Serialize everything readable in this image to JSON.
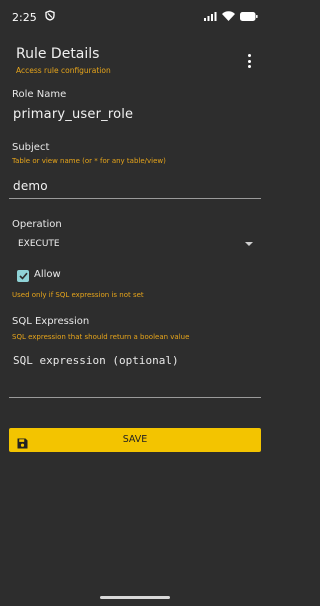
{
  "status_bar": {
    "time": "2:25"
  },
  "header": {
    "title": "Rule Details",
    "subtitle": "Access rule configuration"
  },
  "form": {
    "role_name": {
      "label": "Role Name",
      "value": "primary_user_role"
    },
    "subject": {
      "label": "Subject",
      "hint": "Table or view name (or * for any table/view)",
      "value": "demo"
    },
    "operation": {
      "label": "Operation",
      "selected": "EXECUTE"
    },
    "allow": {
      "label": "Allow",
      "checked": true,
      "hint": "Used only if SQL expression is not set"
    },
    "sql_expression": {
      "label": "SQL Expression",
      "hint": "SQL expression that should return a boolean value",
      "placeholder": "SQL expression (optional)"
    }
  },
  "save_button": {
    "label": "SAVE"
  },
  "colors": {
    "background": "#2d2d2d",
    "accent_orange": "#e7a51b",
    "save_button": "#f3c400",
    "checkbox": "#8fd2d6"
  }
}
